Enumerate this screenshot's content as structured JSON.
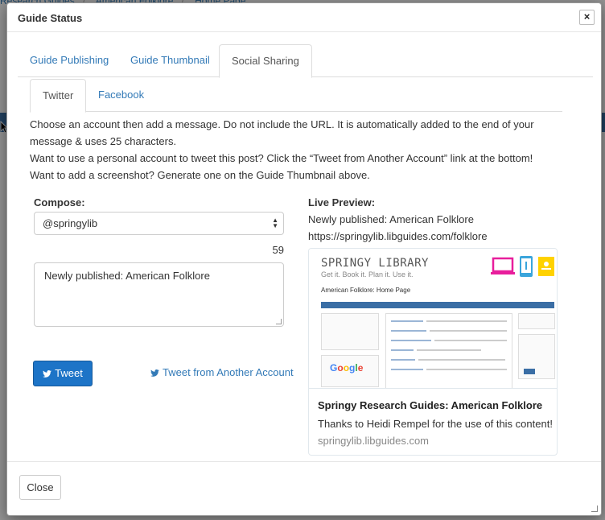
{
  "background": {
    "breadcrumbs": [
      "Research Guides",
      "American Folklore",
      "Home Page"
    ]
  },
  "modal": {
    "title": "Guide Status",
    "close_symbol": "×"
  },
  "main_tabs": [
    {
      "label": "Guide Publishing",
      "active": false
    },
    {
      "label": "Guide Thumbnail",
      "active": false
    },
    {
      "label": "Social Sharing",
      "active": true
    }
  ],
  "sub_tabs": [
    {
      "label": "Twitter",
      "active": true
    },
    {
      "label": "Facebook",
      "active": false
    }
  ],
  "instructions": [
    "Choose an account then add a message. Do not include the URL. It is automatically added to the end of your message & uses 25 characters.",
    "Want to use a personal account to tweet this post? Click the “Tweet from Another Account” link at the bottom!",
    "Want to add a screenshot? Generate one on the Guide Thumbnail above."
  ],
  "compose": {
    "label": "Compose:",
    "account": "@springylib",
    "char_count": "59",
    "message": "Newly published: American Folklore",
    "tweet_button": "Tweet",
    "tweet_other_link": "Tweet from Another Account"
  },
  "preview": {
    "label": "Live Preview:",
    "text": "Newly published: American Folklore",
    "url": "https://springylib.libguides.com/folklore",
    "card": {
      "logo": "SPRINGY LIBRARY",
      "tagline": "Get it. Book it. Plan it. Use it.",
      "page_heading": "American Folklore: Home Page",
      "title": "Springy Research Guides: American Folklore",
      "description": "Thanks to Heidi Rempel for the use of this content!",
      "domain": "springylib.libguides.com"
    }
  },
  "footer": {
    "close_button": "Close"
  },
  "colors": {
    "link": "#337ab7",
    "tweet_button": "#1d74c7",
    "laptop": "#e81e9c",
    "tablet": "#3ba5dc",
    "sticky_note": "#ffd200",
    "calendar": "#6cbf3f"
  }
}
